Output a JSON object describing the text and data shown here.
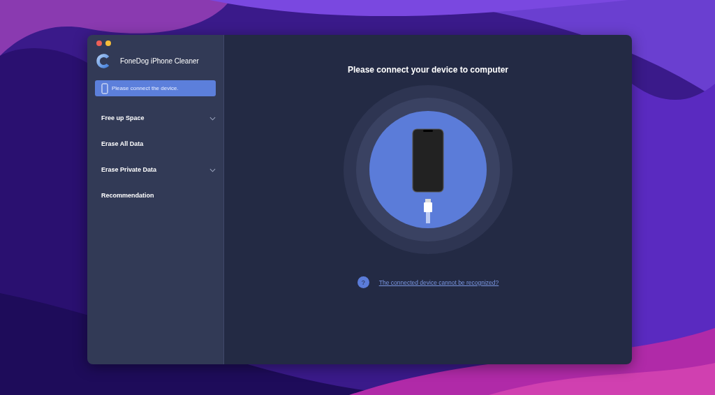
{
  "app": {
    "name": "FoneDog iPhone Cleaner"
  },
  "device_status": {
    "text": "Please connect the device."
  },
  "sidebar": {
    "items": [
      {
        "label": "Free up Space",
        "expandable": true
      },
      {
        "label": "Erase All Data",
        "expandable": false
      },
      {
        "label": "Erase Private Data",
        "expandable": true
      },
      {
        "label": "Recommendation",
        "expandable": false
      }
    ]
  },
  "main": {
    "heading": "Please connect your device to computer",
    "help_icon": "?",
    "help_link": "The connected device cannot be recognized?"
  }
}
